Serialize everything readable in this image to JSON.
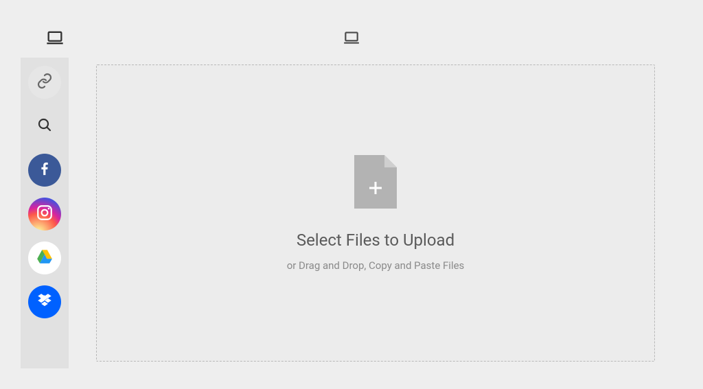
{
  "header": {
    "left_icon": "laptop-icon",
    "center_icon": "laptop-icon"
  },
  "sidebar": {
    "items": [
      {
        "name": "link",
        "icon": "link-icon"
      },
      {
        "name": "search",
        "icon": "search-icon"
      },
      {
        "name": "facebook",
        "icon": "facebook-icon"
      },
      {
        "name": "instagram",
        "icon": "instagram-icon"
      },
      {
        "name": "gdrive",
        "icon": "google-drive-icon"
      },
      {
        "name": "dropbox",
        "icon": "dropbox-icon"
      }
    ]
  },
  "dropzone": {
    "title": "Select Files to Upload",
    "subtitle": "or Drag and Drop, Copy and Paste Files"
  }
}
